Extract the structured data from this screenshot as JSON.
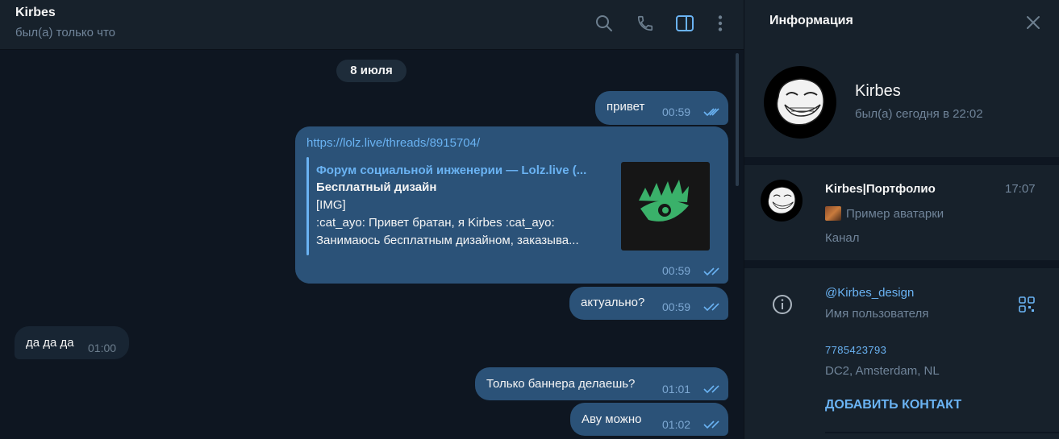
{
  "chat": {
    "title": "Kirbes",
    "status": "был(а) только что",
    "header_icons": [
      "search-icon",
      "phone-icon",
      "sidebar-toggle-icon",
      "more-vertical-icon"
    ],
    "date_divider": "8 июля",
    "messages": [
      {
        "direction": "out",
        "text": "привет",
        "time": "00:59",
        "read": true
      },
      {
        "direction": "out",
        "link": "https://lolz.live/threads/8915704/",
        "preview": {
          "site": "Форум социальной инженерии —  Lolz.live (...",
          "title": "Бесплатный дизайн",
          "lines": [
            "[IMG]",
            ":cat_ayo:  Привет братан, я Kirbes :cat_ayo:",
            "Занимаюсь бесплатным дизайном, заказыва..."
          ]
        },
        "time": "00:59",
        "read": true
      },
      {
        "direction": "out",
        "text": "актуально?",
        "time": "00:59",
        "read": true
      },
      {
        "direction": "in",
        "text": "да да да",
        "time": "01:00"
      },
      {
        "direction": "out",
        "text": "Только баннера делаешь?",
        "time": "01:01",
        "read": true
      },
      {
        "direction": "out",
        "text": "Аву можно",
        "time": "01:02",
        "read": true
      }
    ]
  },
  "info": {
    "title": "Информация",
    "profile": {
      "name": "Kirbes",
      "status": "был(а) сегодня в 22:02"
    },
    "channel": {
      "name": "Kirbes|Портфолио",
      "time": "17:07",
      "last_message": "Пример аватарки",
      "kind": "Канал"
    },
    "username": "@Kirbes_design",
    "username_label": "Имя пользователя",
    "user_id": "7785423793",
    "datacenter": "DC2, Amsterdam, NL",
    "add_contact": "ДОБАВИТЬ КОНТАКТ"
  },
  "colors": {
    "background": "#0e1621",
    "panel": "#17212b",
    "bubble_out": "#2b5278",
    "bubble_in": "#182533",
    "accent": "#6ab3f3",
    "secondary_text": "#708499",
    "preview_logo": "#3ab16a"
  }
}
